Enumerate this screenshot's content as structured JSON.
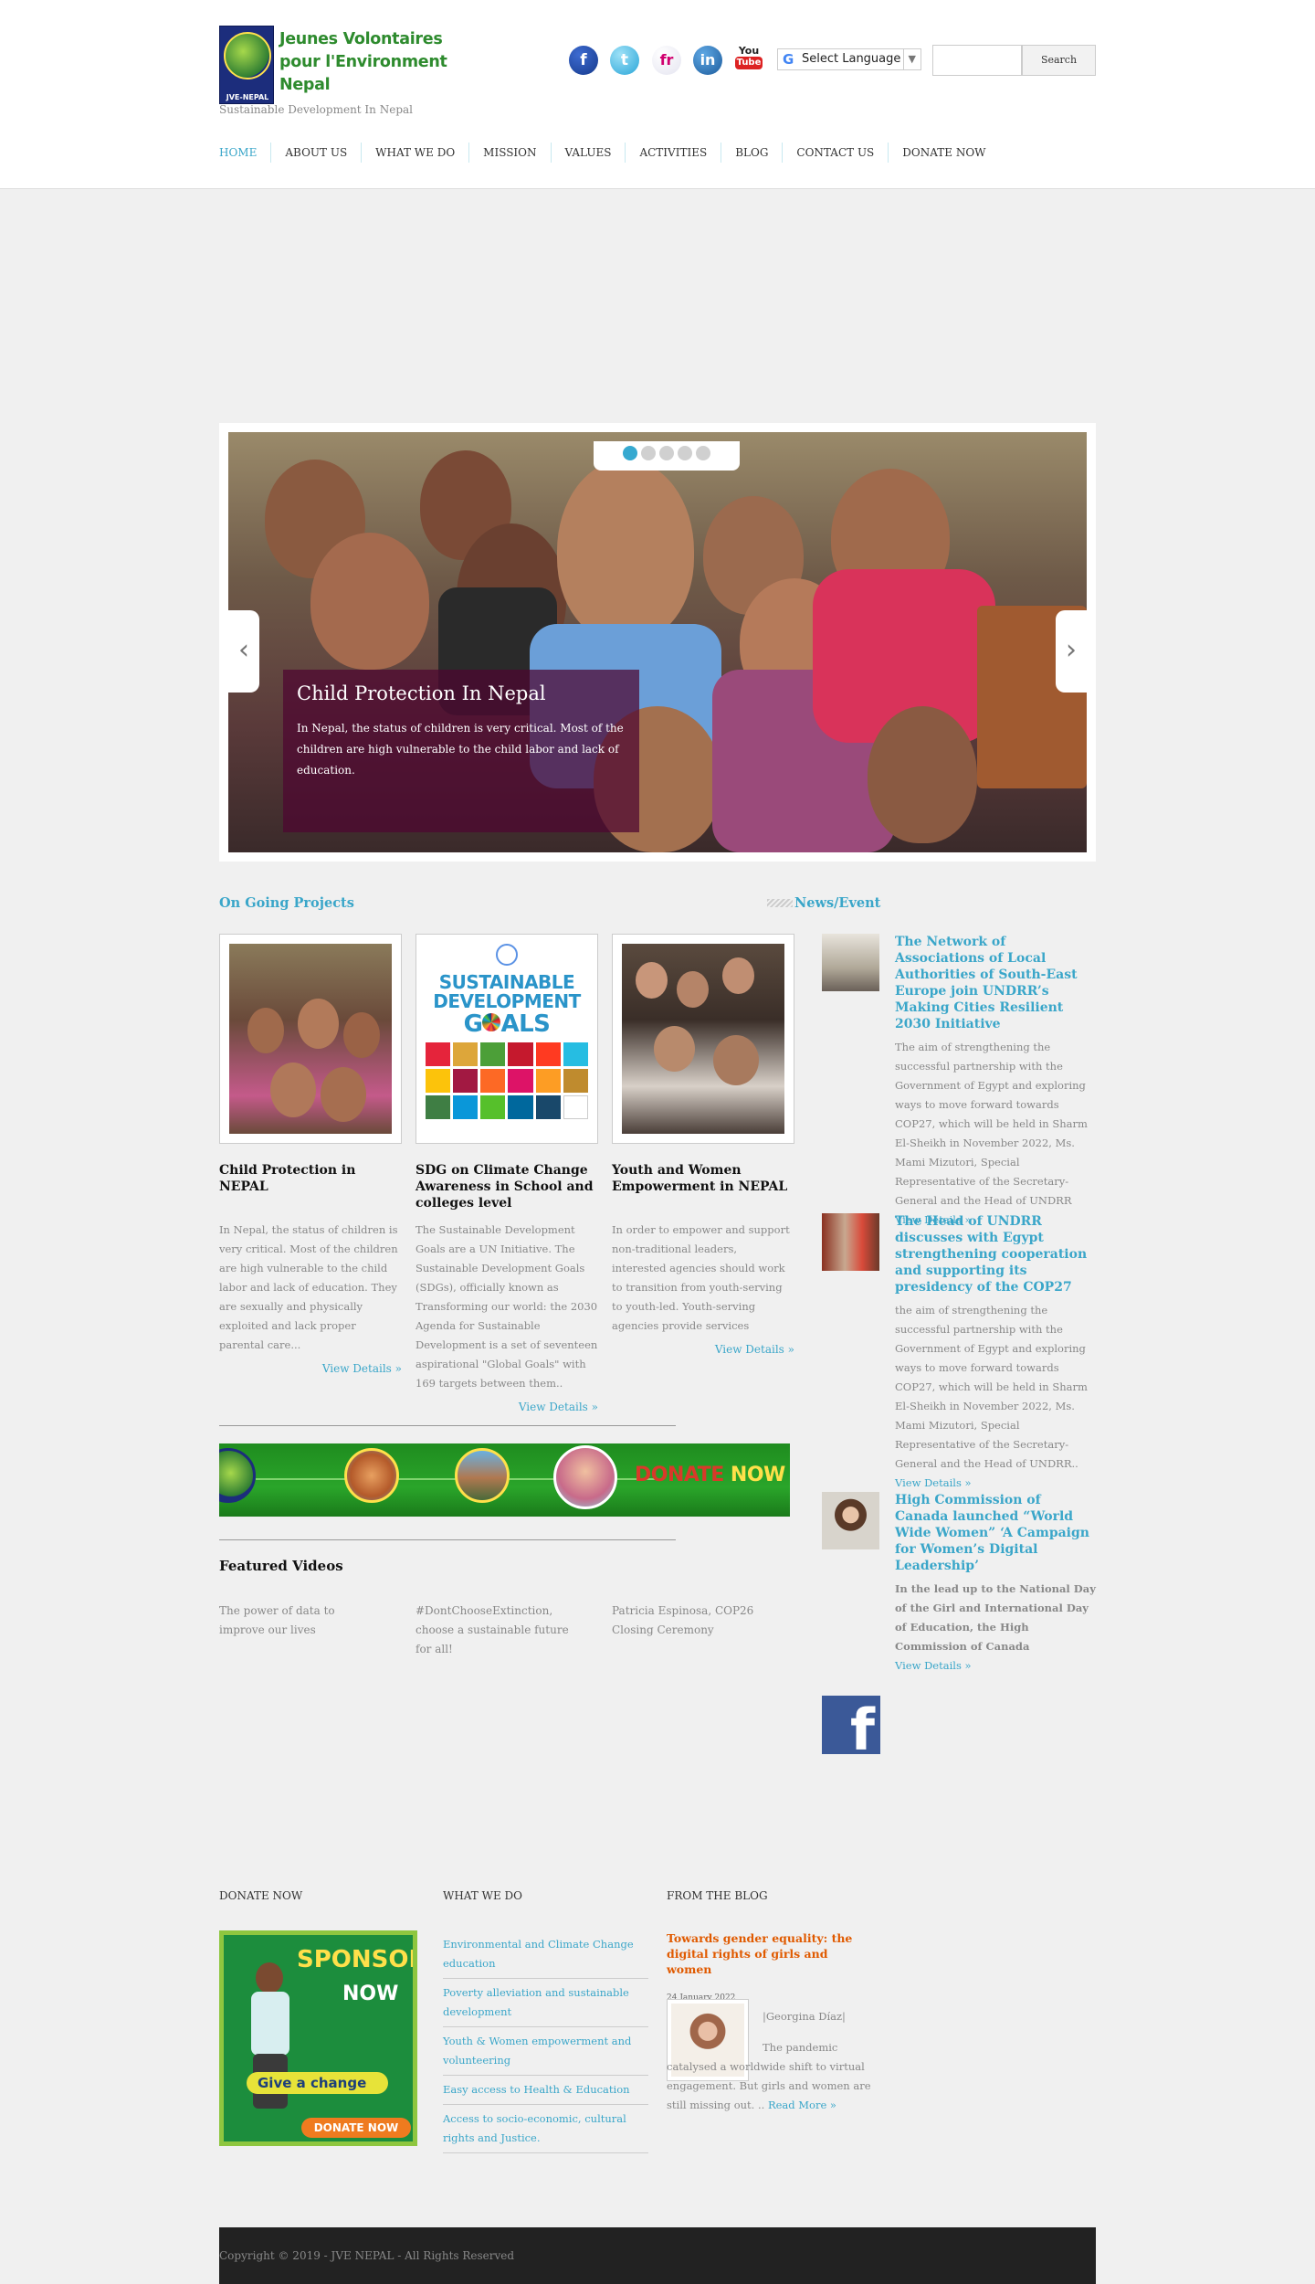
{
  "header": {
    "logo_lines": [
      "Jeunes Volontaires",
      "pour l'Environment",
      "Nepal"
    ],
    "logo_badge": "JVE-NEPAL",
    "tagline": "Sustainable Development In Nepal",
    "social": [
      "facebook-icon",
      "twitter-icon",
      "friendfeed-icon",
      "linkedin-icon",
      "youtube-icon"
    ],
    "social_glyphs": {
      "facebook": "f",
      "twitter": "t",
      "fr": "fr",
      "linkedin": "in",
      "youtube_top": "You",
      "youtube_bottom": "Tube"
    },
    "language": "Select Language",
    "search_value": "",
    "search_button": "Search"
  },
  "nav": [
    "HOME",
    "ABOUT US",
    "WHAT WE DO",
    "MISSION",
    "VALUES",
    "ACTIVITIES",
    "BLOG",
    "CONTACT US",
    "DONATE NOW"
  ],
  "slider": {
    "title": "Child Protection In Nepal",
    "text": "In Nepal, the status of children is very critical. Most of the children are high vulnerable to the child labor and lack of education.",
    "active_dot": 1,
    "dots": 5
  },
  "projects": {
    "title": "On Going Projects",
    "items": [
      {
        "title": "Child Protection in NEPAL",
        "text": "In Nepal, the status of children is very critical. Most of the children are high vulnerable to the child labor and lack of education. They are sexually and physically exploited and lack proper parental care...",
        "more": "View Details »"
      },
      {
        "title": "SDG on Climate Change Awareness in School and colleges level",
        "text": "The Sustainable Development Goals are a UN Initiative. The Sustainable Development Goals (SDGs), officially known as Transforming our world: the 2030 Agenda for Sustainable Development is a set of seventeen aspirational \"Global Goals\" with 169 targets between them..",
        "more": "View Details »"
      },
      {
        "title": "Youth and Women Empowerment in NEPAL",
        "text": "In order to empower and support non-traditional leaders, interested agencies should work to transition from youth-serving to youth-led. Youth-serving agencies provide services",
        "more": "View Details »"
      }
    ],
    "sdg_lines": [
      "SUSTAINABLE",
      "DEVELOPMENT",
      "G",
      "ALS"
    ]
  },
  "banner": {
    "word1": "DONATE",
    "word2": "NOW"
  },
  "videos": {
    "title": "Featured Videos",
    "items": [
      "The power of data to improve our lives",
      "#DontChooseExtinction, choose a sustainable future for all!",
      "Patricia Espinosa, COP26 Closing Ceremony"
    ]
  },
  "news": {
    "title": "News/Event",
    "items": [
      {
        "title": "The Network of Associations of Local Authorities of South-East Europe join UNDRR’s Making Cities Resilient 2030 Initiative",
        "text": "The aim of strengthening the successful partnership with the Government of Egypt and exploring ways to move forward towards COP27, which will be held in Sharm El-Sheikh in November 2022, Ms. Mami Mizutori, Special Representative of the Secretary-General and the Head of UNDRR",
        "more": "View Details »"
      },
      {
        "title": "The Head of UNDRR discusses with Egypt strengthening cooperation and supporting its presidency of the COP27",
        "text": "the aim of strengthening the successful partnership with the Government of Egypt and exploring ways to move forward towards COP27, which will be held in Sharm El-Sheikh in November 2022, Ms. Mami Mizutori, Special Representative of the Secretary-General and the Head of UNDRR..",
        "more": "View Details »"
      },
      {
        "title": "High Commission of Canada launched “World Wide Women” ‘A Campaign for Women’s Digital Leadership’",
        "text": "In the lead up to the National Day of the Girl and International Day of Education, the High Commission of Canada",
        "more": "View Details »"
      }
    ],
    "facebook_glyph": "f"
  },
  "footer": {
    "donate_title": "DONATE NOW",
    "sponsor": {
      "line1": "SPONSOR",
      "line2": "NOW",
      "cta": "Give a change",
      "button": "DONATE NOW"
    },
    "what_title": "WHAT WE DO",
    "what_items": [
      "Environmental and Climate Change education",
      "Poverty alleviation and sustainable development",
      "Youth & Women empowerment and volunteering",
      "Easy access to Health & Education",
      "Access to socio-economic, cultural rights and Justice."
    ],
    "blog_title": "FROM THE BLOG",
    "blog_post": {
      "title": "Towards gender equality: the digital rights of girls and women",
      "date": "24 January 2022",
      "author": "|Georgina Díaz|",
      "text": "The pandemic catalysed a worldwide shift to virtual engagement. But girls and women are still missing out. ..",
      "more": "Read More »"
    }
  },
  "copyright": "Copyright © 2019 - JVE NEPAL - All Rights Reserved"
}
